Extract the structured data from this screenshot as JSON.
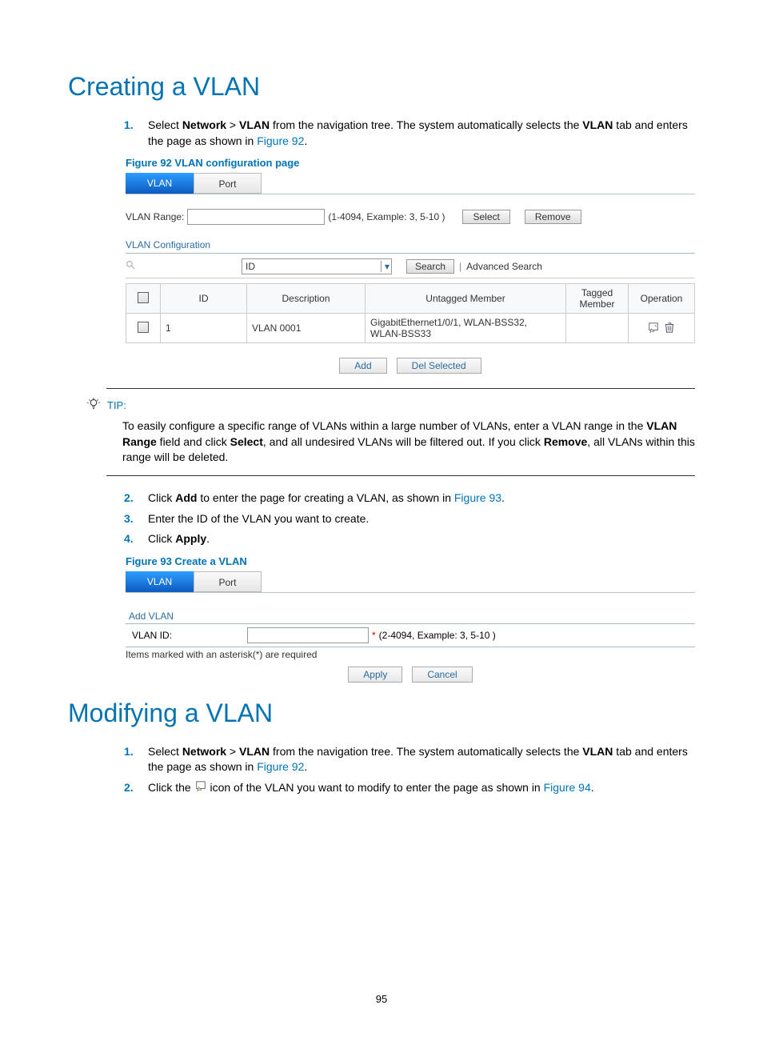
{
  "heading1": "Creating a VLAN",
  "step1": {
    "num": "1.",
    "text_a": "Select ",
    "bold_a": "Network",
    "text_b": " > ",
    "bold_b": "VLAN",
    "text_c": " from the navigation tree. The system automatically selects the ",
    "bold_c": "VLAN",
    "text_d": " tab and enters the page as shown in ",
    "link": "Figure 92",
    "text_e": "."
  },
  "fig92_caption": "Figure 92 VLAN configuration page",
  "fig92": {
    "tab_vlan": "VLAN",
    "tab_port": "Port",
    "vlan_range_label": "VLAN Range:",
    "range_hint": "(1-4094, Example: 3, 5-10 )",
    "btn_select": "Select",
    "btn_remove": "Remove",
    "section_title": "VLAN Configuration",
    "select_id": "ID",
    "btn_search": "Search",
    "adv_search": "Advanced Search",
    "th_id": "ID",
    "th_desc": "Description",
    "th_untagged": "Untagged Member",
    "th_tagged": "Tagged Member",
    "th_operation": "Operation",
    "row_id": "1",
    "row_desc": "VLAN 0001",
    "row_untagged": "GigabitEthernet1/0/1, WLAN-BSS32, WLAN-BSS33",
    "btn_add": "Add",
    "btn_del": "Del Selected"
  },
  "tip": {
    "label": "TIP:",
    "text_a": "To easily configure a specific range of VLANs within a large number of VLANs, enter a VLAN range in the ",
    "bold_a": "VLAN Range",
    "text_b": " field and click ",
    "bold_b": "Select",
    "text_c": ", and all undesired VLANs will be filtered out. If you click ",
    "bold_c": "Remove",
    "text_d": ", all VLANs within this range will be deleted."
  },
  "step2": {
    "num": "2.",
    "text_a": "Click ",
    "bold_a": "Add",
    "text_b": " to enter the page for creating a VLAN, as shown in ",
    "link": "Figure 93",
    "text_c": "."
  },
  "step3": {
    "num": "3.",
    "text": "Enter the ID of the VLAN you want to create."
  },
  "step4": {
    "num": "4.",
    "text_a": "Click ",
    "bold_a": "Apply",
    "text_b": "."
  },
  "fig93_caption": "Figure 93 Create a VLAN",
  "fig93": {
    "tab_vlan": "VLAN",
    "tab_port": "Port",
    "section": "Add VLAN",
    "vlan_id_label": "VLAN ID:",
    "asterisk": "*",
    "hint": "(2-4094, Example: 3, 5-10 )",
    "req_note": "Items marked with an asterisk(*) are required",
    "btn_apply": "Apply",
    "btn_cancel": "Cancel"
  },
  "heading2": "Modifying a VLAN",
  "mod_step1": {
    "num": "1.",
    "text_a": "Select ",
    "bold_a": "Network",
    "text_b": " > ",
    "bold_b": "VLAN",
    "text_c": " from the navigation tree. The system automatically selects the ",
    "bold_c": "VLAN",
    "text_d": " tab and enters the page as shown in ",
    "link": "Figure 92",
    "text_e": "."
  },
  "mod_step2": {
    "num": "2.",
    "text_a": "Click the ",
    "text_b": " icon of the VLAN you want to modify to enter the page as shown in ",
    "link": "Figure 94",
    "text_c": "."
  },
  "page_number": "95"
}
